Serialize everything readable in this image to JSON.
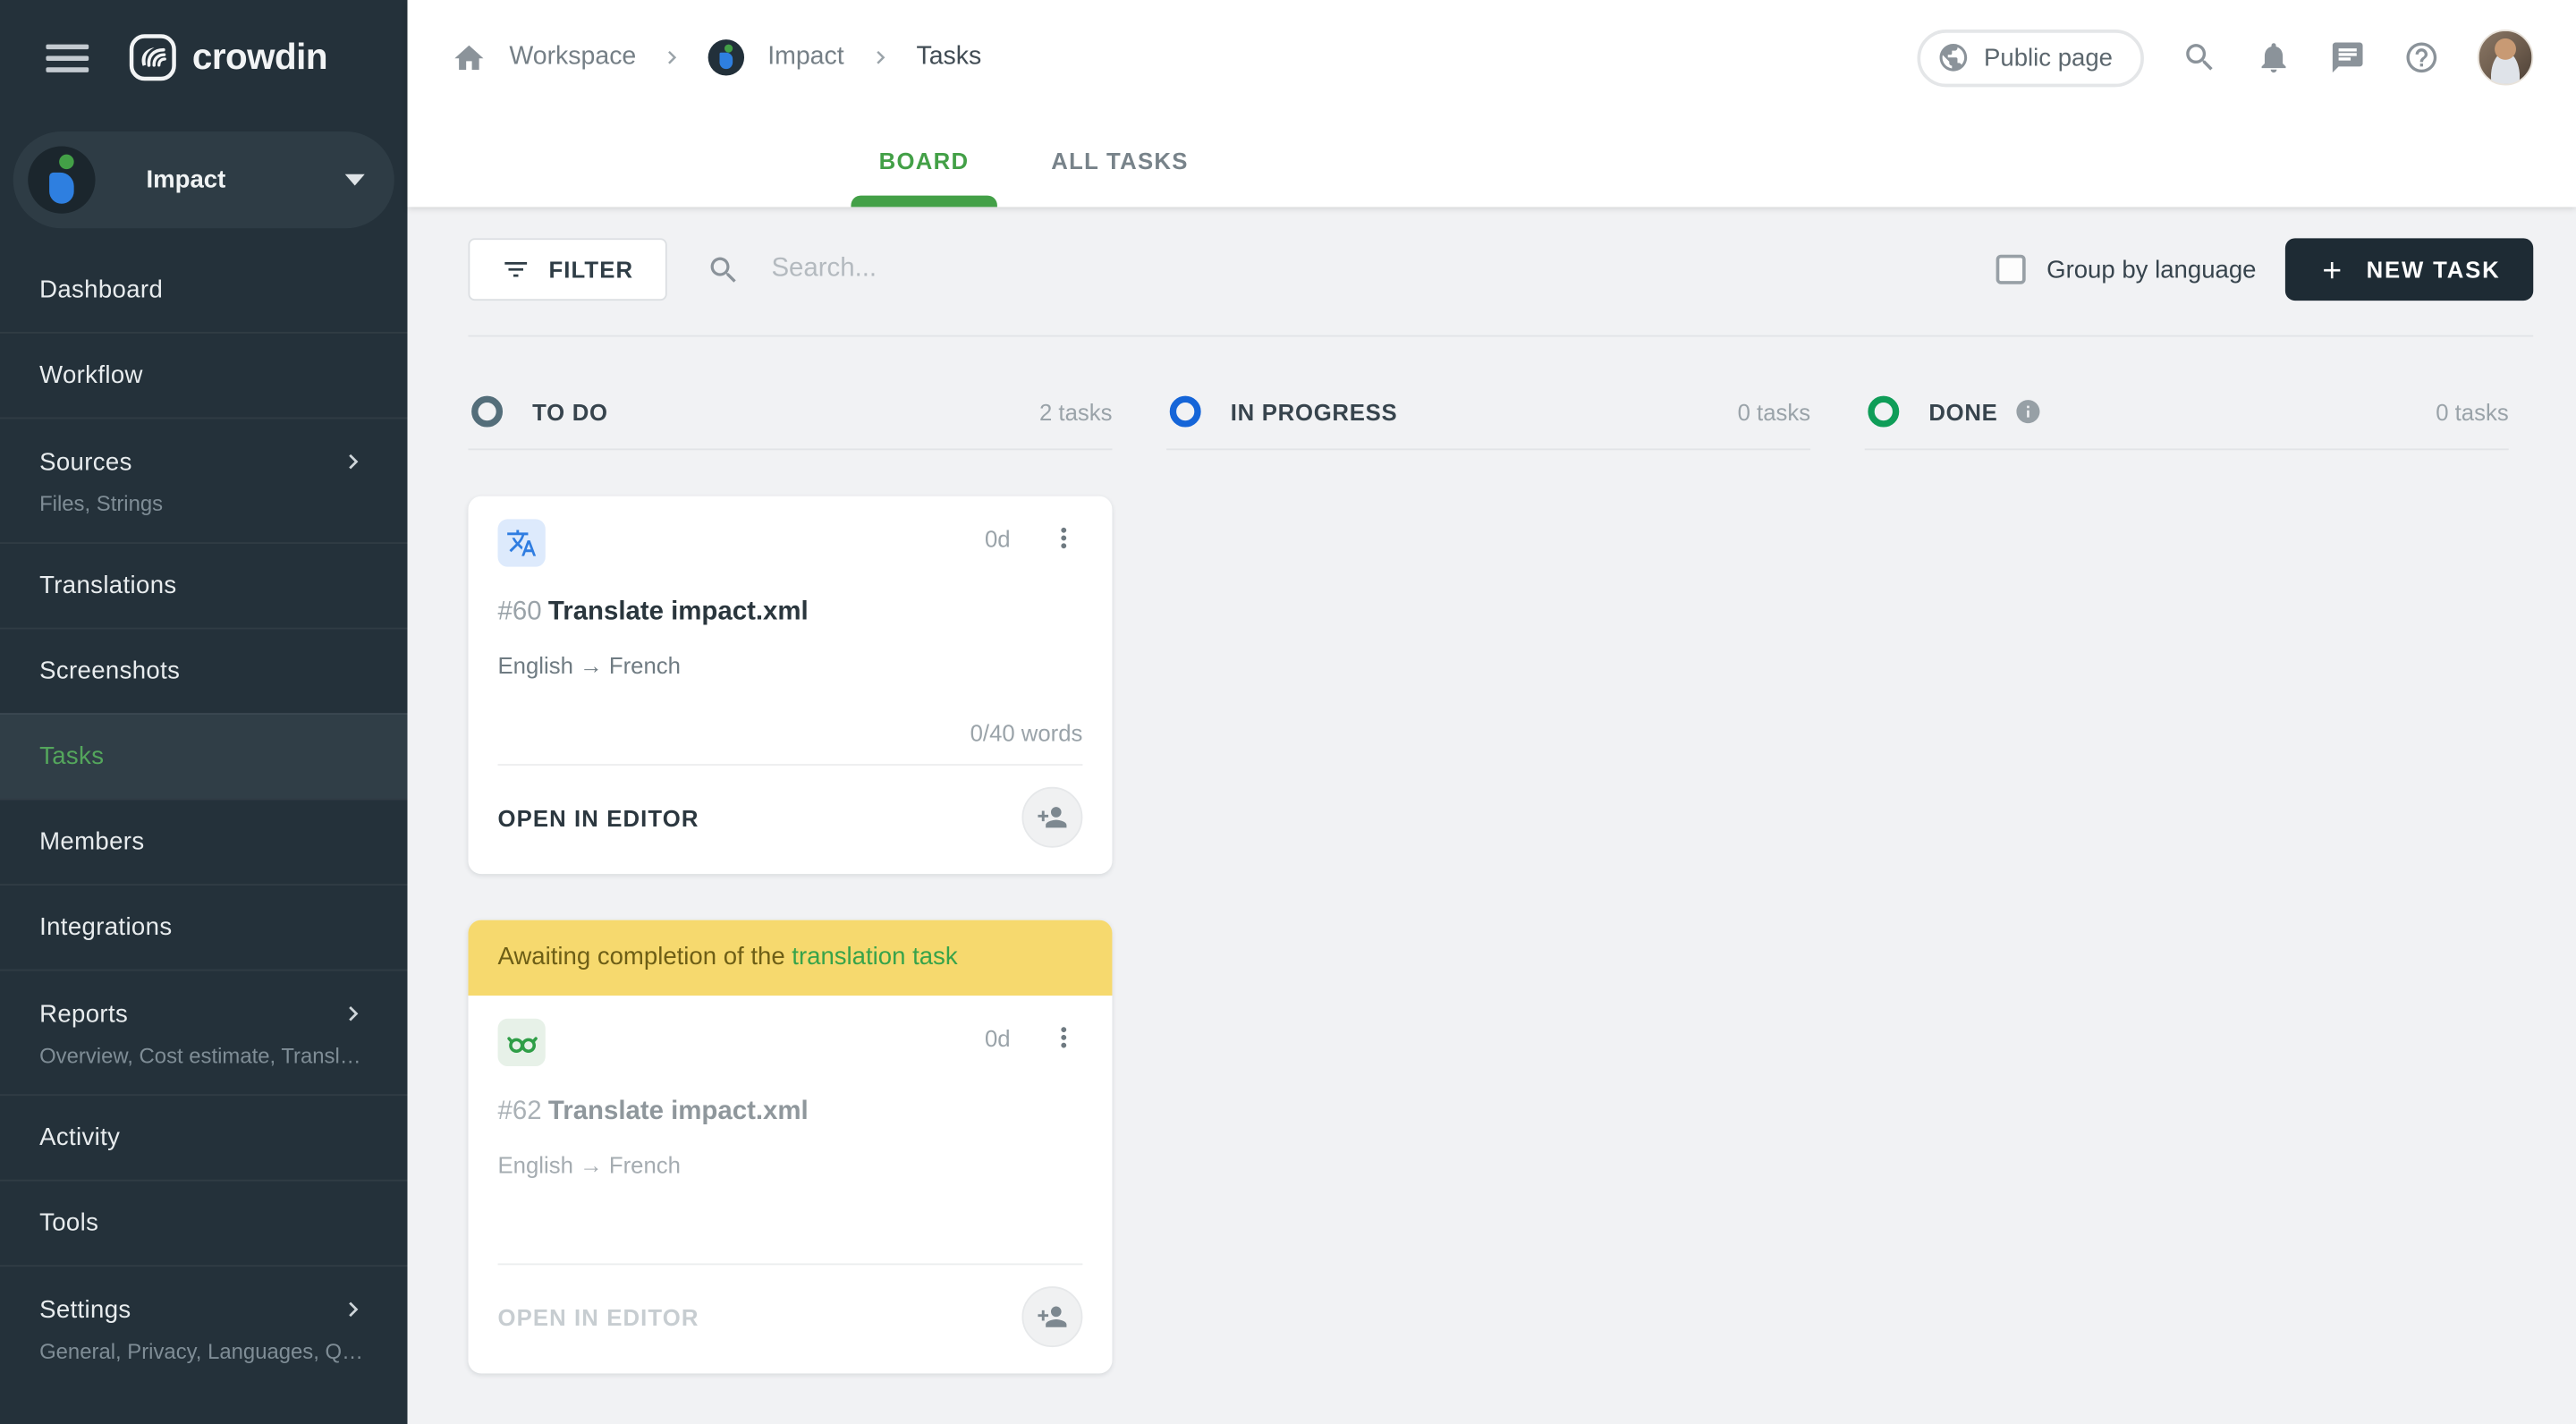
{
  "app": {
    "brand": "crowdin",
    "accent_green": "#43a047",
    "column_colors": {
      "todo": "#546e7a",
      "in_progress": "#1565d8",
      "done": "#0f9d58"
    },
    "banner_yellow": "#f6d96e",
    "dark_button": "#1e2b34"
  },
  "sidebar": {
    "project": {
      "name": "Impact"
    },
    "items": [
      {
        "label": "Dashboard"
      },
      {
        "label": "Workflow"
      },
      {
        "label": "Sources",
        "subtitle": "Files, Strings"
      },
      {
        "label": "Translations"
      },
      {
        "label": "Screenshots"
      },
      {
        "label": "Tasks"
      },
      {
        "label": "Members"
      },
      {
        "label": "Integrations"
      },
      {
        "label": "Reports",
        "subtitle": "Overview, Cost estimate, Transl…"
      },
      {
        "label": "Activity"
      },
      {
        "label": "Tools"
      },
      {
        "label": "Settings",
        "subtitle": "General, Privacy, Languages, Q…"
      }
    ]
  },
  "header": {
    "breadcrumb": {
      "workspace": "Workspace",
      "project": "Impact",
      "page": "Tasks"
    },
    "public_page": "Public page"
  },
  "tabs": {
    "board": "BOARD",
    "all_tasks": "ALL TASKS"
  },
  "toolbar": {
    "filter": "FILTER",
    "search_placeholder": "Search...",
    "group_by": "Group by language",
    "new_task": "NEW TASK"
  },
  "board": {
    "columns": [
      {
        "name": "TO DO",
        "count": "2 tasks"
      },
      {
        "name": "IN PROGRESS",
        "count": "0 tasks"
      },
      {
        "name": "DONE",
        "count": "0 tasks"
      }
    ],
    "cards": [
      {
        "id": "#60",
        "title": "Translate impact.xml",
        "languages": "English → French",
        "due": "0d",
        "progress": "0/40 words",
        "action": "OPEN IN EDITOR"
      },
      {
        "id": "#62",
        "title": "Translate impact.xml",
        "languages": "English → French",
        "due": "0d",
        "action": "OPEN IN EDITOR",
        "banner": {
          "text": "Awaiting completion of the ",
          "link": "translation task"
        }
      }
    ]
  }
}
